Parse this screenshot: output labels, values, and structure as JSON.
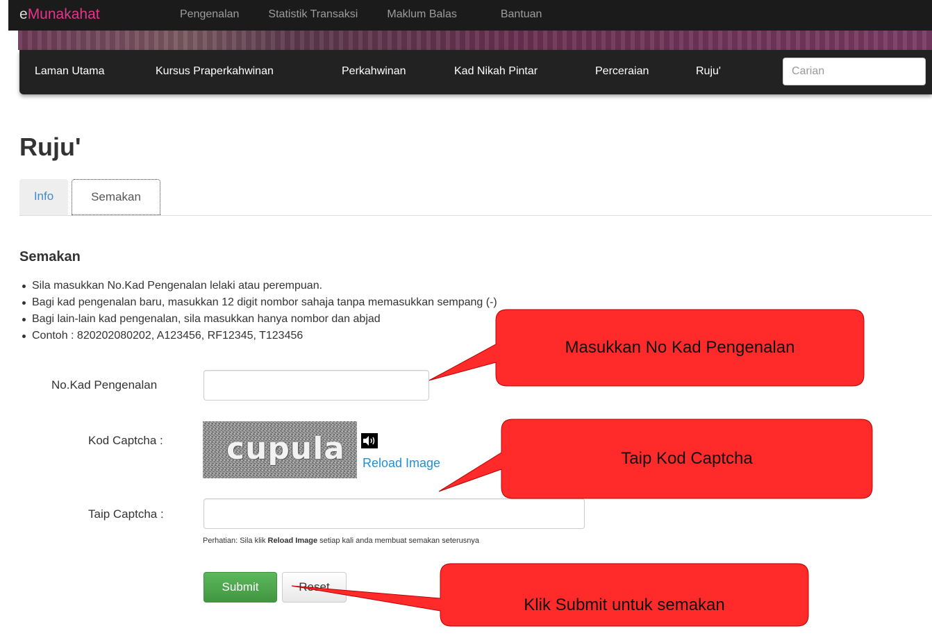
{
  "topbar": {
    "brand_prefix": "e",
    "brand_highlight": "Munakahat",
    "links": [
      "Pengenalan",
      "Statistik Transaksi",
      "Maklum Balas",
      "Bantuan"
    ]
  },
  "mainnav": {
    "items": [
      "Laman Utama",
      "Kursus Praperkahwinan",
      "Perkahwinan",
      "Kad Nikah Pintar",
      "Perceraian",
      "Ruju'"
    ],
    "search_placeholder": "Carian"
  },
  "page": {
    "title": "Ruju'",
    "tabs": [
      "Info",
      "Semakan"
    ],
    "section_title": "Semakan",
    "instructions": [
      "Sila masukkan No.Kad Pengenalan lelaki atau perempuan.",
      "Bagi kad pengenalan baru, masukkan 12 digit nombor sahaja tanpa memasukkan sempang (-)",
      "Bagi lain-lain kad pengenalan, sila masukkan hanya nombor dan abjad",
      "Contoh : 820202080202, A123456, RF12345, T123456"
    ]
  },
  "form": {
    "ic_label": "No.Kad Pengenalan",
    "ic_value": "",
    "captcha_label": "Kod Captcha :",
    "captcha_text": "cupula",
    "reload_label": "Reload Image",
    "type_captcha_label": "Taip Captcha :",
    "type_captcha_value": "",
    "note_prefix": "Perhatian: Sila klik ",
    "note_bold": "Reload Image",
    "note_suffix": " setiap kali anda membuat semakan seterusnya",
    "submit_label": "Submit",
    "reset_label": "Reset"
  },
  "callouts": [
    "Masukkan No Kad Pengenalan",
    "Taip Kod Captcha",
    "Klik Submit untuk semakan"
  ],
  "colors": {
    "brand_accent": "#e8358a",
    "link": "#428bca",
    "callout_fill": "#ff2a2a",
    "submit_green": "#5cb85c"
  }
}
